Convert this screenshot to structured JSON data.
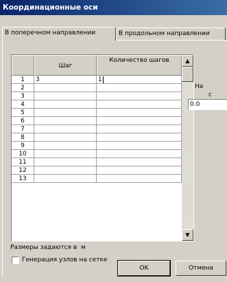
{
  "window": {
    "title": "Координационные оси"
  },
  "tabs": [
    {
      "label": "В поперечном направлении"
    },
    {
      "label": "В продольном направлении"
    }
  ],
  "grid": {
    "columns": [
      "",
      "Шаг",
      "Количество шагов"
    ],
    "rows": [
      {
        "n": "1",
        "step": "3",
        "count": "1"
      },
      {
        "n": "2",
        "step": "",
        "count": ""
      },
      {
        "n": "3",
        "step": "",
        "count": ""
      },
      {
        "n": "4",
        "step": "",
        "count": ""
      },
      {
        "n": "5",
        "step": "",
        "count": ""
      },
      {
        "n": "6",
        "step": "",
        "count": ""
      },
      {
        "n": "7",
        "step": "",
        "count": ""
      },
      {
        "n": "8",
        "step": "",
        "count": ""
      },
      {
        "n": "9",
        "step": "",
        "count": ""
      },
      {
        "n": "10",
        "step": "",
        "count": ""
      },
      {
        "n": "11",
        "step": "",
        "count": ""
      },
      {
        "n": "12",
        "step": "",
        "count": ""
      },
      {
        "n": "13",
        "step": "",
        "count": ""
      }
    ]
  },
  "units_label": "Размеры задаются в",
  "units_value": "м",
  "right_partial": {
    "line1": "На",
    "line2": "с",
    "value": "0.0"
  },
  "checkbox": {
    "label": "Генерация узлов на сетке",
    "checked": false
  },
  "buttons": {
    "ok": "OK",
    "cancel": "Отмена"
  }
}
